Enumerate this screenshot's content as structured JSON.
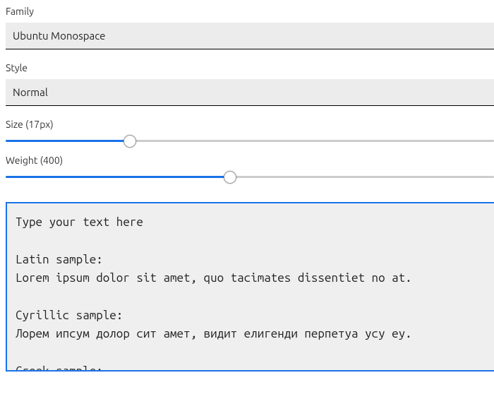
{
  "family": {
    "label": "Family",
    "value": "Ubuntu Monospace"
  },
  "style": {
    "label": "Style",
    "value": "Normal"
  },
  "size": {
    "label": "Size (17px)",
    "value": 17,
    "min": 8,
    "max": 48,
    "fill_percent": 25.5
  },
  "weight": {
    "label": "Weight (400)",
    "value": 400,
    "min": 100,
    "max": 900,
    "fill_percent": 46
  },
  "preview": {
    "placeholder": "Type your text here",
    "text": "Type your text here\n\nLatin sample:\nLorem ipsum dolor sit amet, quo tacimates dissentiet no at.\n\nCyrillic sample:\nЛорем ипсум долор сит амет, видит елигенди перпетуа усу еу.\n\nGreek sample:\nΛορεμ ιπσθμ δολορ σιτ αμετ, μεα νατθμ ηαβεμθσ νο σιτ."
  }
}
